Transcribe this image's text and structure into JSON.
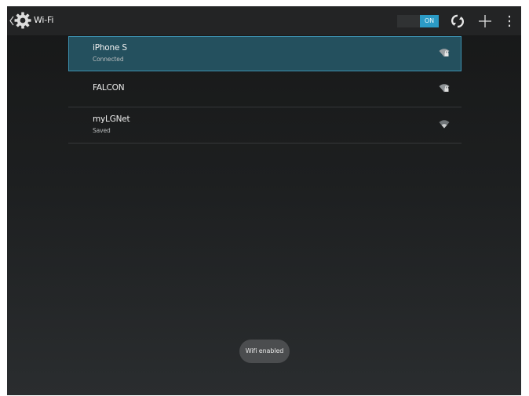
{
  "header": {
    "title": "Wi-Fi",
    "toggle_label": "ON",
    "toggle_on": true
  },
  "networks": [
    {
      "ssid": "iPhone S",
      "status": "Connected",
      "secured": true,
      "selected": true
    },
    {
      "ssid": "FALCON",
      "status": "",
      "secured": true,
      "selected": false
    },
    {
      "ssid": "myLGNet",
      "status": "Saved",
      "secured": false,
      "selected": false
    }
  ],
  "toast": {
    "text": "Wifi enabled"
  },
  "colors": {
    "accent": "#2b9bc6",
    "selected_row": "#24505e",
    "selected_border": "#3c8fae"
  }
}
